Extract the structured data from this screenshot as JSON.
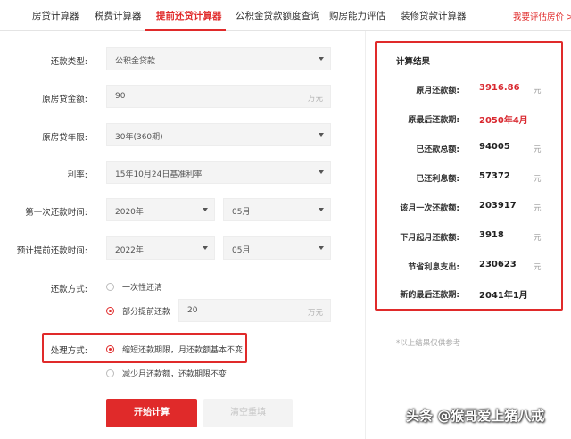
{
  "tabs": [
    {
      "label": "房贷计算器"
    },
    {
      "label": "税费计算器"
    },
    {
      "label": "提前还贷计算器"
    },
    {
      "label": "公积金贷款额度查询"
    },
    {
      "label": "购房能力评估"
    },
    {
      "label": "装修贷款计算器"
    }
  ],
  "tab_link": "我要评估房价 >",
  "form": {
    "loan_type": {
      "label": "还款类型:",
      "value": "公积金贷款"
    },
    "amount": {
      "label": "原房贷金额:",
      "value": "90",
      "unit": "万元"
    },
    "term": {
      "label": "原房贷年限:",
      "value": "30年(360期)"
    },
    "rate": {
      "label": "利率:",
      "value": "15年10月24日基准利率"
    },
    "first_repay": {
      "label": "第一次还款时间:",
      "year": "2020年",
      "month": "05月"
    },
    "prepay_time": {
      "label": "预计提前还款时间:",
      "year": "2022年",
      "month": "05月"
    },
    "repay_method": {
      "label": "还款方式:",
      "option1": "一次性还清",
      "option2": "部分提前还款",
      "partial_value": "20",
      "partial_unit": "万元"
    },
    "handling": {
      "label": "处理方式:",
      "option1": "缩短还款期限，月还款额基本不变",
      "option2": "减少月还款额，还款期限不变"
    },
    "submit": "开始计算",
    "reset": "清空重填"
  },
  "result": {
    "title": "计算结果",
    "rows": [
      {
        "label": "原月还款额:",
        "value": "3916.86",
        "unit": "元"
      },
      {
        "label": "原最后还款期:",
        "value": "2050年4月",
        "unit": ""
      },
      {
        "label": "已还款总额:",
        "value": "94005",
        "unit": "元"
      },
      {
        "label": "已还利息额:",
        "value": "57372",
        "unit": "元"
      },
      {
        "label": "该月一次还款额:",
        "value": "203917",
        "unit": "元"
      },
      {
        "label": "下月起月还款额:",
        "value": "3918",
        "unit": "元"
      },
      {
        "label": "节省利息支出:",
        "value": "230623",
        "unit": "元"
      },
      {
        "label": "新的最后还款期:",
        "value": "2041年1月",
        "unit": ""
      }
    ],
    "note": "*以上结果仅供参考"
  },
  "watermark": "头条 @猴哥爱上猪八戒",
  "colors": {
    "accent": "#e02a2a"
  }
}
